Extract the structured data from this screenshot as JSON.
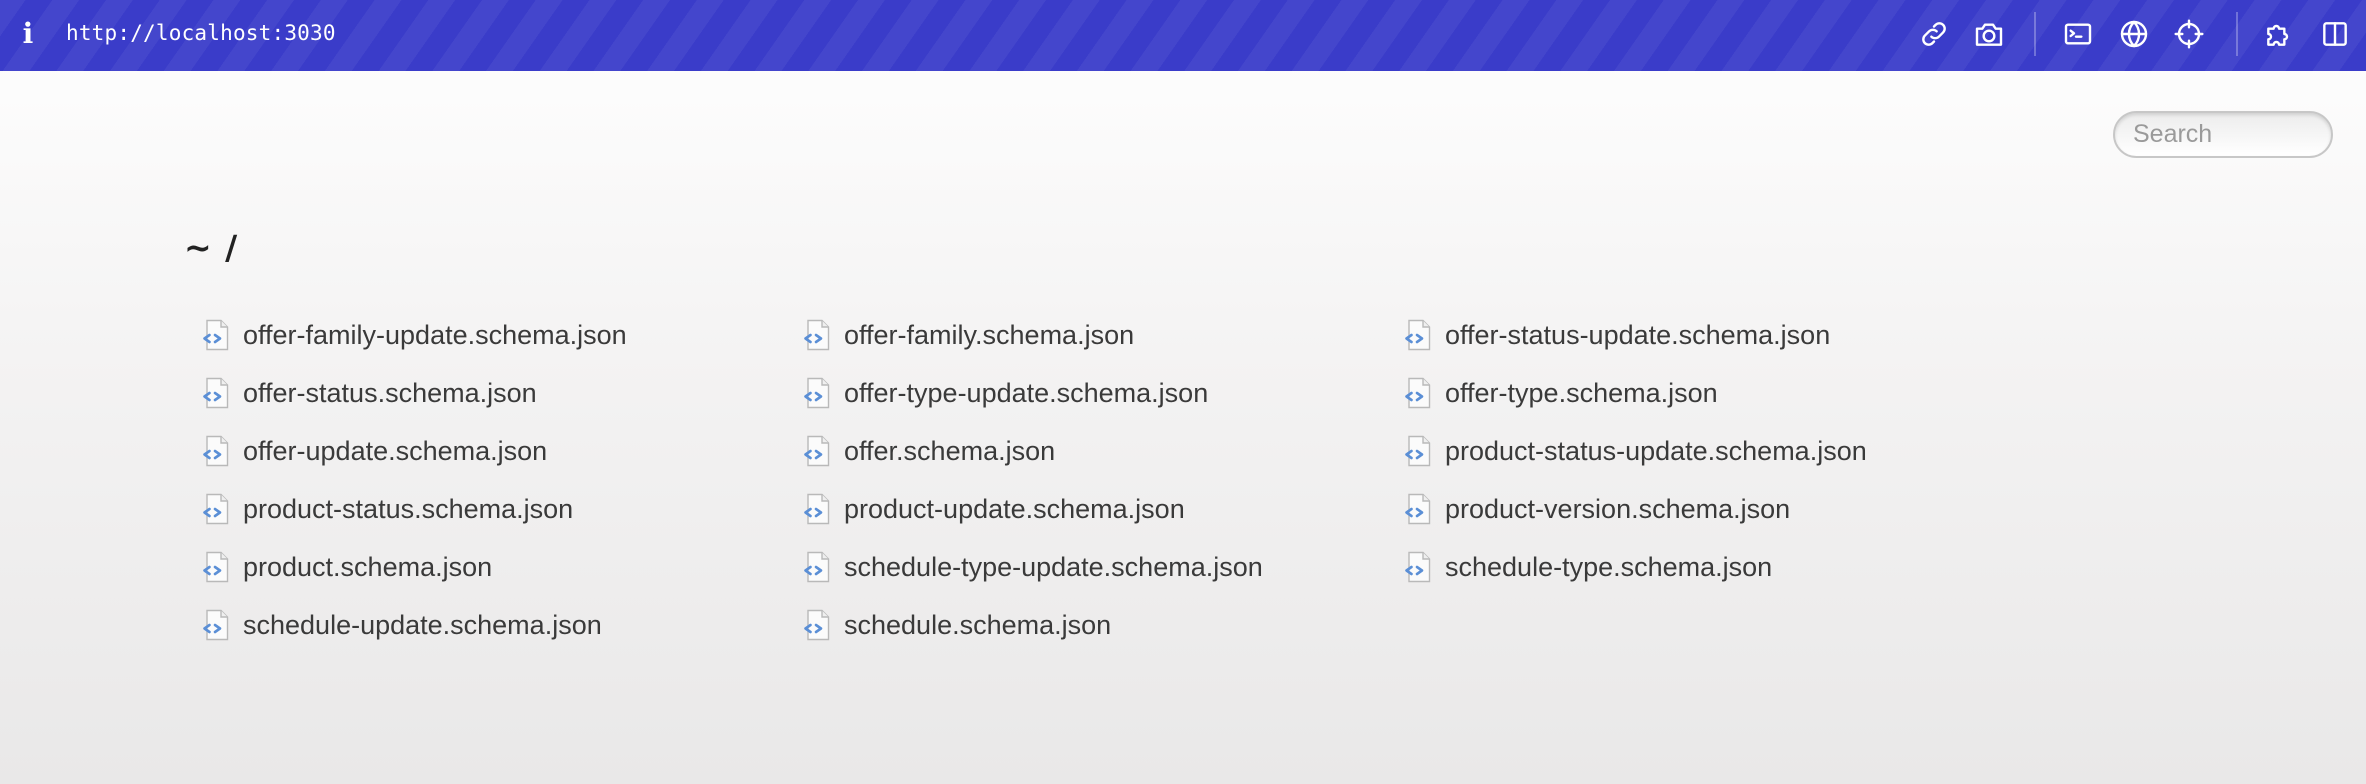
{
  "toolbar": {
    "info_label": "i",
    "url": "http://localhost:3030",
    "icons": [
      "link-icon",
      "camera-icon",
      "terminal-icon",
      "globe-icon",
      "crosshair-icon",
      "puzzle-icon",
      "sidebar-icon"
    ]
  },
  "search": {
    "placeholder": "Search",
    "value": ""
  },
  "breadcrumb": {
    "home": "~",
    "separator": "/"
  },
  "files": [
    {
      "name": "offer-family-update.schema.json",
      "icon": "json-file-icon"
    },
    {
      "name": "offer-family.schema.json",
      "icon": "json-file-icon"
    },
    {
      "name": "offer-status-update.schema.json",
      "icon": "json-file-icon"
    },
    {
      "name": "offer-status.schema.json",
      "icon": "json-file-icon"
    },
    {
      "name": "offer-type-update.schema.json",
      "icon": "json-file-icon"
    },
    {
      "name": "offer-type.schema.json",
      "icon": "json-file-icon"
    },
    {
      "name": "offer-update.schema.json",
      "icon": "json-file-icon"
    },
    {
      "name": "offer.schema.json",
      "icon": "json-file-icon"
    },
    {
      "name": "product-status-update.schema.json",
      "icon": "json-file-icon"
    },
    {
      "name": "product-status.schema.json",
      "icon": "json-file-icon"
    },
    {
      "name": "product-update.schema.json",
      "icon": "json-file-icon"
    },
    {
      "name": "product-version.schema.json",
      "icon": "json-file-icon"
    },
    {
      "name": "product.schema.json",
      "icon": "json-file-icon"
    },
    {
      "name": "schedule-type-update.schema.json",
      "icon": "json-file-icon"
    },
    {
      "name": "schedule-type.schema.json",
      "icon": "json-file-icon"
    },
    {
      "name": "schedule-update.schema.json",
      "icon": "json-file-icon"
    },
    {
      "name": "schedule.schema.json",
      "icon": "json-file-icon"
    }
  ],
  "colors": {
    "toolbar_bg": "#3a3cc9",
    "file_text": "#3a3a3a",
    "icon_accent": "#5b8fd6"
  }
}
